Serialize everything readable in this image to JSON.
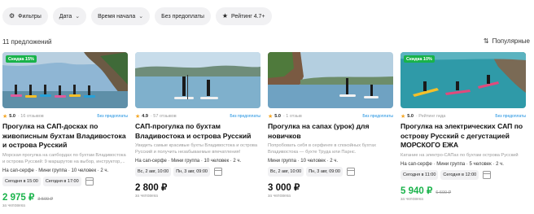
{
  "filters": [
    {
      "label": "Фильтры",
      "icon": "sliders-icon"
    },
    {
      "label": "Дата",
      "chevron": true
    },
    {
      "label": "Время начала",
      "chevron": true
    },
    {
      "label": "Без предоплаты"
    },
    {
      "label": "Рейтинг 4.7+",
      "icon": "star-icon"
    }
  ],
  "results_count": "11 предложений",
  "sort_label": "Популярные",
  "colors": {
    "green": "#19b34a",
    "blue": "#1a8fe0",
    "star": "#f5a623"
  },
  "cards": [
    {
      "badge": "Скидка 15%",
      "rating": "5.0",
      "reviews": "· 16 отзывов",
      "no_prepay": "Без предоплаты",
      "title": "Прогулка на САП-досках по живописным бухтам Владивостока и острова Русский",
      "desc": "Морская прогулка на сапбордах по бухтам Владивостока и острова Русский: 9 маршрутов на выбор, инструктор,...",
      "tags": "На сап-серфе · Мини группа · 10 человек · 2 ч.",
      "dates": [
        "Сегодня в 15:00",
        "Сегодня в 17:00"
      ],
      "price": "2 975 ₽",
      "old_price": "3 500 ₽",
      "per": "за человека"
    },
    {
      "badge": "",
      "rating": "4.9",
      "reviews": "· 57 отзывов",
      "no_prepay": "Без предоплаты",
      "title": "САП-прогулка по бухтам Владивостока и острова Русский",
      "desc": "Увидеть самые красивые бухты Владивостока и острова Русский и получить незабываемые впечатления!",
      "tags": "На сап-серфе · Мини группа · 10 человек · 2 ч.",
      "dates": [
        "Вс, 2 авг, 10:00",
        "Пн, 3 авг, 09:00"
      ],
      "price": "2 800 ₽",
      "old_price": "",
      "per": "за человека"
    },
    {
      "badge": "",
      "rating": "5.0",
      "reviews": "· 1 отзыв",
      "no_prepay": "Без предоплаты",
      "title": "Прогулка на сапах (урок) для новичков",
      "desc": "Попробовать себя в серфинге в спокойных бухтах Владивостока — бухте Труда или Парнс.",
      "tags": "Мини группа · 10 человек · 2 ч.",
      "dates": [
        "Вс, 2 авг, 10:00",
        "Пн, 3 авг, 09:00"
      ],
      "price": "3 000 ₽",
      "old_price": "",
      "per": "за человека"
    },
    {
      "badge": "Скидка 10%",
      "rating": "5.0",
      "reviews": "· Рейтинг гида",
      "no_prepay": "Без предоплаты",
      "title": "Прогулка на электрических САП по острову Русский с дегустацией МОРСКОГО ЕЖА",
      "desc": "Катание на электро-САПах по бухтам острова Русский",
      "tags": "На сап-серфе · Мини группа · 5 человек · 2 ч.",
      "dates": [
        "Сегодня в 11:00",
        "Сегодня в 12:00"
      ],
      "price": "5 940 ₽",
      "old_price": "6 600 ₽",
      "per": "за человека"
    }
  ]
}
